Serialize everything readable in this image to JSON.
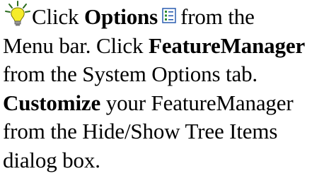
{
  "tip": {
    "lightbulb_icon": "lightbulb-icon",
    "options_icon": "options-checklist-icon",
    "seg1": "Click ",
    "options_bold": "Options",
    "seg2": "from the",
    "seg3": "Menu bar. Click ",
    "featuremanager_bold": "FeatureManager",
    "seg4": "from the System Options tab.",
    "customize_bold": "Customize",
    "seg5": " your FeatureManager",
    "seg6": "from the Hide/Show Tree Items",
    "seg7": "dialog box."
  },
  "colors": {
    "bulb_yellow": "#f5ec2a",
    "bulb_rays": "#2a6b1e",
    "icon_green": "#2e8b2e",
    "icon_blue": "#2a5db0"
  }
}
